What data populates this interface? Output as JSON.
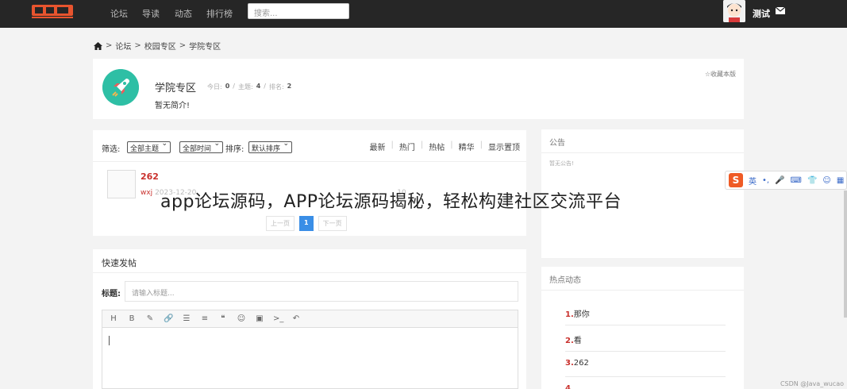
{
  "topbar": {
    "nav": [
      "论坛",
      "导读",
      "动态",
      "排行榜"
    ],
    "search_placeholder": "搜索...",
    "username": "测试"
  },
  "breadcrumb": [
    "论坛",
    "校园专区",
    "学院专区"
  ],
  "forum": {
    "title": "学院专区",
    "stats": {
      "today_label": "今日:",
      "today": "0",
      "topics_label": "主题:",
      "topics": "4",
      "rank_label": "排名:",
      "rank": "2"
    },
    "desc": "暂无简介!",
    "favorite": "☆收藏本版"
  },
  "filters": {
    "label": "筛选:",
    "topic": "全部主题",
    "time": "全部时间",
    "sort_label": "排序:",
    "sort": "默认排序",
    "links": [
      "最新",
      "热门",
      "热帖",
      "精华",
      "显示置顶"
    ]
  },
  "topics": [
    {
      "title": "262",
      "author": "wxj",
      "date": "2023-12-20",
      "tail": "10",
      "ago": "前"
    }
  ],
  "pager": {
    "prev": "上一页",
    "current": "1",
    "next": "下一页"
  },
  "quickpost": {
    "heading": "快速发帖",
    "title_label": "标题:",
    "title_placeholder": "请输入标题...",
    "toolbar": [
      "H",
      "B",
      "✎",
      "🔗",
      "☰",
      "≡",
      "❝",
      "☺",
      "▣",
      ">_",
      "↶"
    ]
  },
  "notice": {
    "heading": "公告",
    "text": "暂无公告!"
  },
  "hot": {
    "heading": "热点动态",
    "items": [
      {
        "num": "1.",
        "text": "那你"
      },
      {
        "num": "2.",
        "text": "看"
      },
      {
        "num": "3.",
        "text": "262"
      },
      {
        "num": "4.",
        "text": "...."
      }
    ]
  },
  "overlay": {
    "caption": "app论坛源码，APP论坛源码揭秘，轻松构建社区交流平台",
    "ime_label": "英",
    "watermark": "CSDN @Java_wucao"
  },
  "colors": {
    "accent": "#c9302c",
    "primary": "#3a8ee6",
    "forum_icon": "#2ebfa5",
    "topbar": "#262626"
  }
}
